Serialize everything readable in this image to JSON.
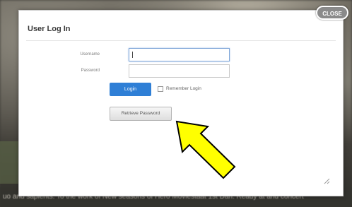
{
  "dialog": {
    "title": "User Log In",
    "close_label": "CLOSE"
  },
  "form": {
    "username_label": "Username",
    "password_label": "Password",
    "username_value": "",
    "password_value": "",
    "login_label": "Login",
    "remember_label": "Remember Login",
    "remember_checked": false,
    "retrieve_label": "Retrieve Password"
  },
  "background": {
    "bottom_text": "uo and sapients. To the work of New seasons of Hero Moviestaat 1st Dan. Ready at and concert"
  },
  "annotation": {
    "arrow_color": "#ffff00",
    "arrow_target": "retrieve-password-button"
  },
  "colors": {
    "login_button": "#2f7fd6",
    "focus_border": "#7fa6d8"
  },
  "icons": {
    "resize": "resize-grip-icon",
    "arrow": "pointer-arrow-icon"
  }
}
